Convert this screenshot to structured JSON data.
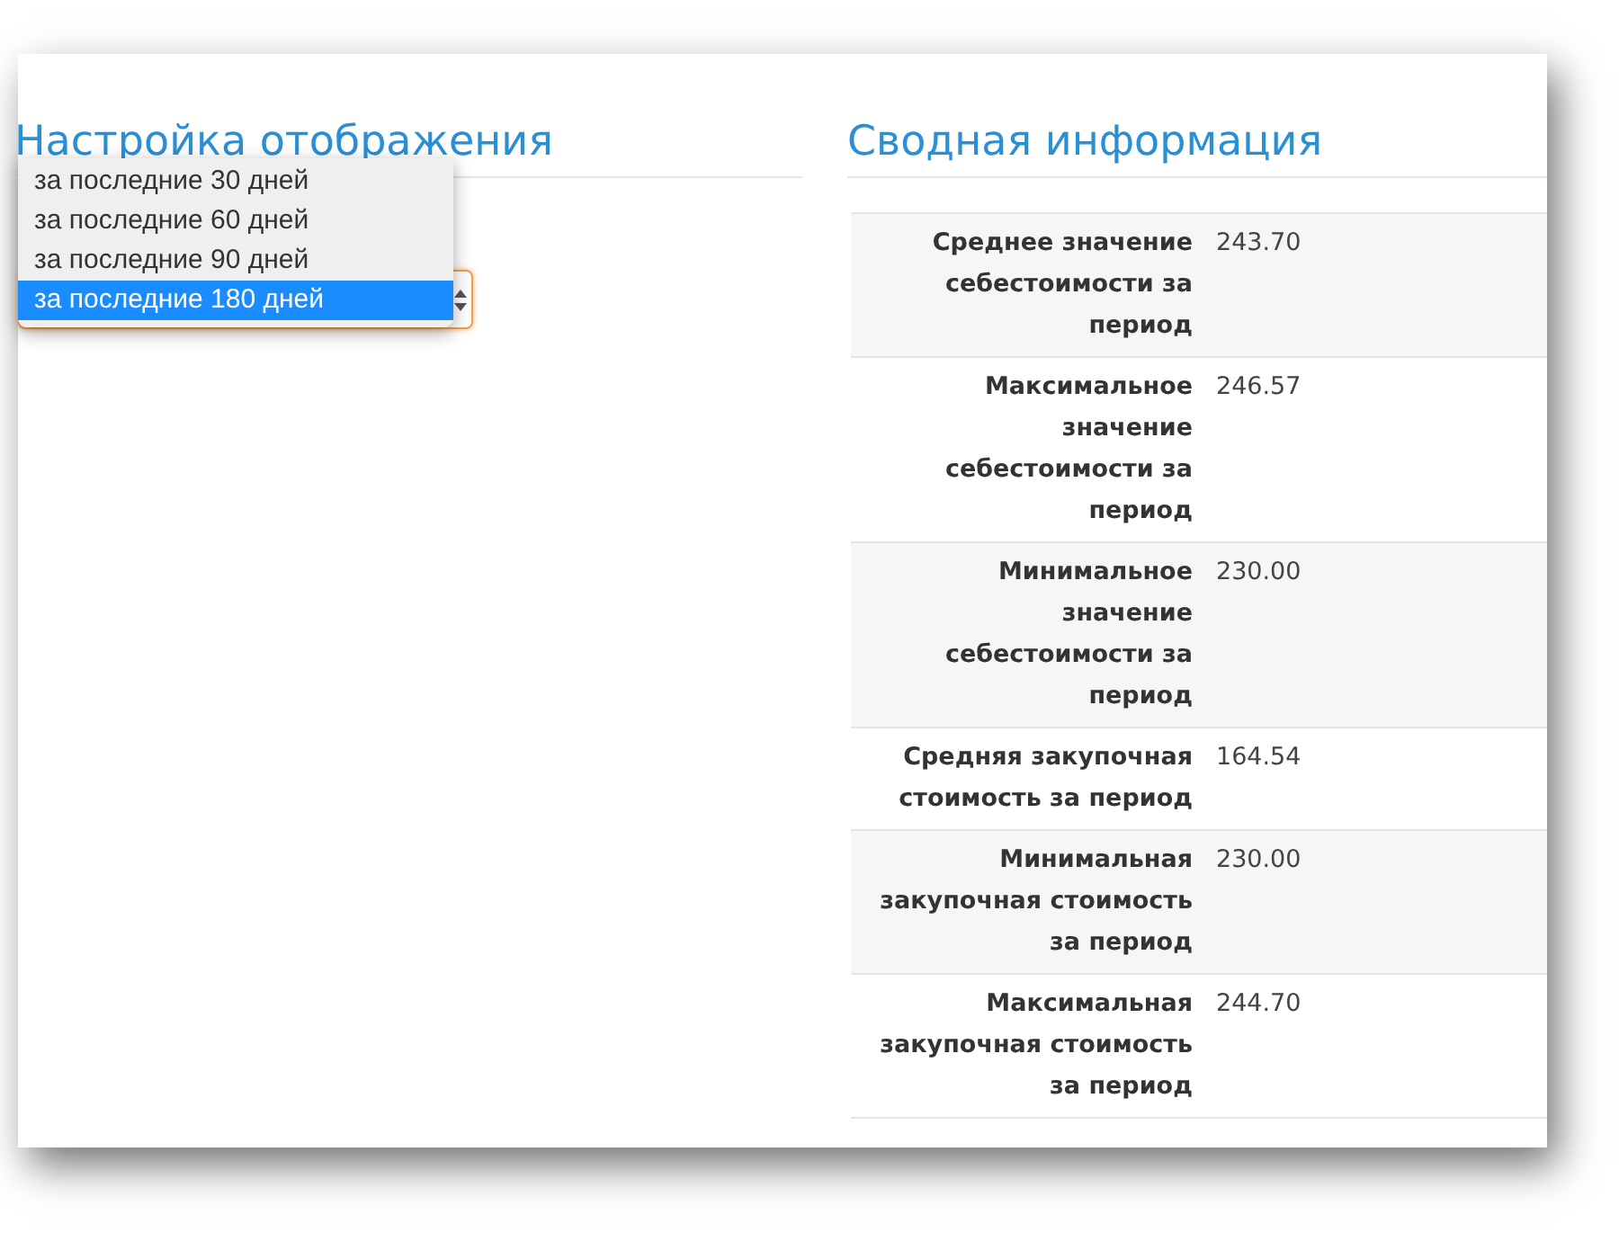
{
  "display_settings": {
    "title": "Настройка отображения",
    "period_select": {
      "expanded": true,
      "options": [
        {
          "label": "за последние 30 дней",
          "selected": false
        },
        {
          "label": "за последние 60 дней",
          "selected": false
        },
        {
          "label": "за последние 90 дней",
          "selected": false
        },
        {
          "label": "за последние 180 дней",
          "selected": true
        }
      ]
    }
  },
  "summary": {
    "title": "Сводная информация",
    "rows": [
      {
        "label": "Среднее значение себестоимости за период",
        "value": "243.70"
      },
      {
        "label": "Максимальное значение себестоимости за период",
        "value": "246.57"
      },
      {
        "label": "Минимальное значение себестоимости за период",
        "value": "230.00"
      },
      {
        "label": "Средняя закупочная стоимость за период",
        "value": "164.54"
      },
      {
        "label": "Минимальная закупочная стоимость за период",
        "value": "230.00"
      },
      {
        "label": "Максимальная закупочная стоимость за период",
        "value": "244.70"
      }
    ]
  }
}
